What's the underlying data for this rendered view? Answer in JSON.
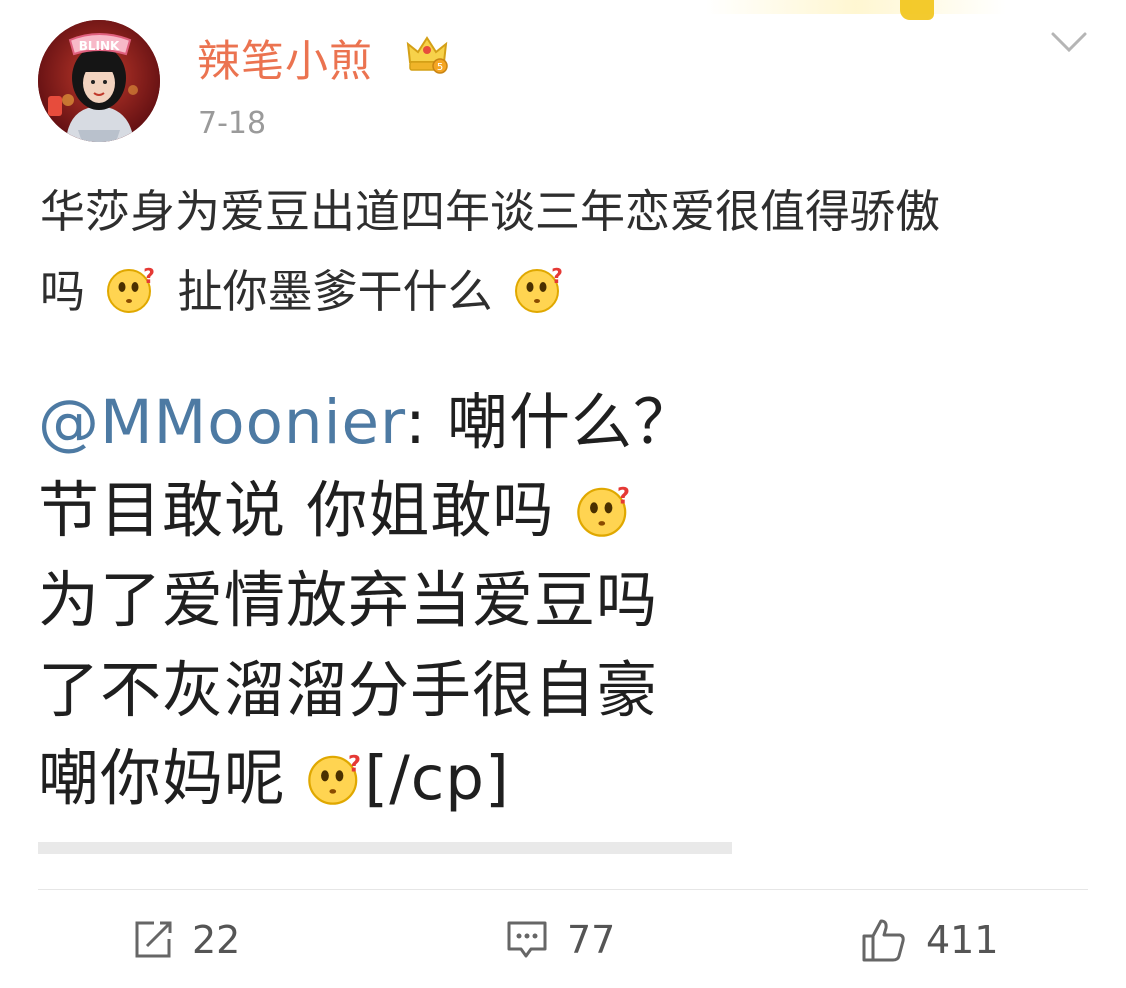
{
  "post": {
    "username": "辣笔小煎",
    "avatar_badge": "BLINK",
    "date": "7-18",
    "text_line1": "华莎身为爱豆出道四年谈三年恋爱很值得骄傲",
    "text_line2_a": "吗",
    "text_line2_b": "扯你墨爹干什么",
    "emoji": "thinking-face-emoji"
  },
  "embedded_image": {
    "mention": "@MMoonier",
    "line1_rest": ": 嘲什么？",
    "line2": "节目敢说 你姐敢吗",
    "line3": "为了爱情放弃当爱豆吗",
    "line4": "了不灰溜溜分手很自豪",
    "line5_a": "嘲你妈呢",
    "line5_b": "[/cp]"
  },
  "actions": {
    "repost_count": "22",
    "comment_count": "77",
    "like_count": "411"
  },
  "colors": {
    "username": "#eb7350",
    "mention": "#4d7aa3",
    "date": "#9a9a9a"
  }
}
